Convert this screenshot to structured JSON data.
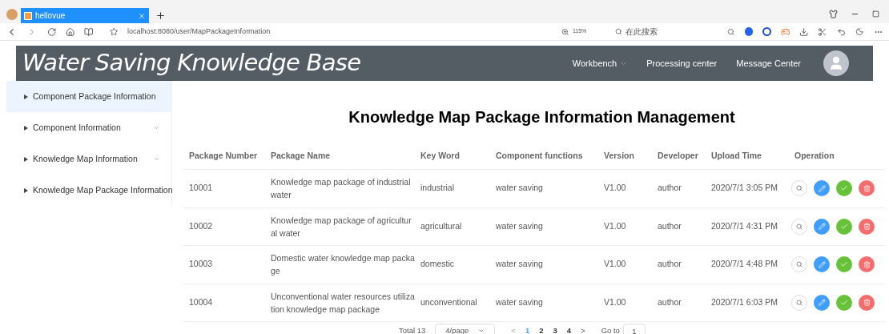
{
  "browser": {
    "tab": {
      "title": "hellovue"
    },
    "address": "localhost:8080/user/MapPackageInformation",
    "zoom": "115%",
    "search": {
      "placeholder": "在此搜索"
    }
  },
  "header": {
    "title": "Water Saving Knowledge Base",
    "nav": [
      {
        "label": "Workbench",
        "dropdown": true
      },
      {
        "label": "Processing center",
        "dropdown": false
      },
      {
        "label": "Message Center",
        "dropdown": false
      }
    ]
  },
  "sidebar": {
    "items": [
      {
        "label": "Component Package Information",
        "selected": true
      },
      {
        "label": "Component Information",
        "selected": false
      },
      {
        "label": "Knowledge Map Information",
        "selected": false
      },
      {
        "label": "Knowledge Map Package Information",
        "selected": false
      }
    ]
  },
  "page_title": "Knowledge Map Package Information Management",
  "table": {
    "columns": [
      "Package Number",
      "Package Name",
      "Key Word",
      "Component functions",
      "Version",
      "Developer",
      "Upload Time",
      "Operation"
    ],
    "rows": [
      {
        "number": "10001",
        "name": [
          "Knowledge map package of industrial",
          "water"
        ],
        "keyword": "industrial",
        "function": "water saving",
        "version": "V1.00",
        "developer": "author",
        "time": "2020/7/1 3:05 PM"
      },
      {
        "number": "10002",
        "name": [
          "Knowledge map package of agricultur",
          "al water"
        ],
        "keyword": "agricultural",
        "function": "water saving",
        "version": "V1.00",
        "developer": "author",
        "time": "2020/7/1 4:31 PM"
      },
      {
        "number": "10003",
        "name": [
          "Domestic water knowledge map packa",
          "ge"
        ],
        "keyword": "domestic",
        "function": "water saving",
        "version": "V1.00",
        "developer": "author",
        "time": "2020/7/1 4:48 PM"
      },
      {
        "number": "10004",
        "name": [
          "Unconventional water resources utiliza",
          "tion knowledge map package"
        ],
        "keyword": "unconventional",
        "function": "water saving",
        "version": "V1.00",
        "developer": "author",
        "time": "2020/7/1 6:03 PM"
      }
    ]
  },
  "pagination": {
    "total": "Total 13",
    "page_size": "4/page",
    "prev": "<",
    "pages": [
      {
        "label": "1",
        "selected": true
      },
      {
        "label": "2",
        "selected": false
      },
      {
        "label": "3",
        "selected": false
      },
      {
        "label": "4",
        "selected": false
      }
    ],
    "next": ">",
    "goto_label": "Go to",
    "goto_value": "1"
  }
}
